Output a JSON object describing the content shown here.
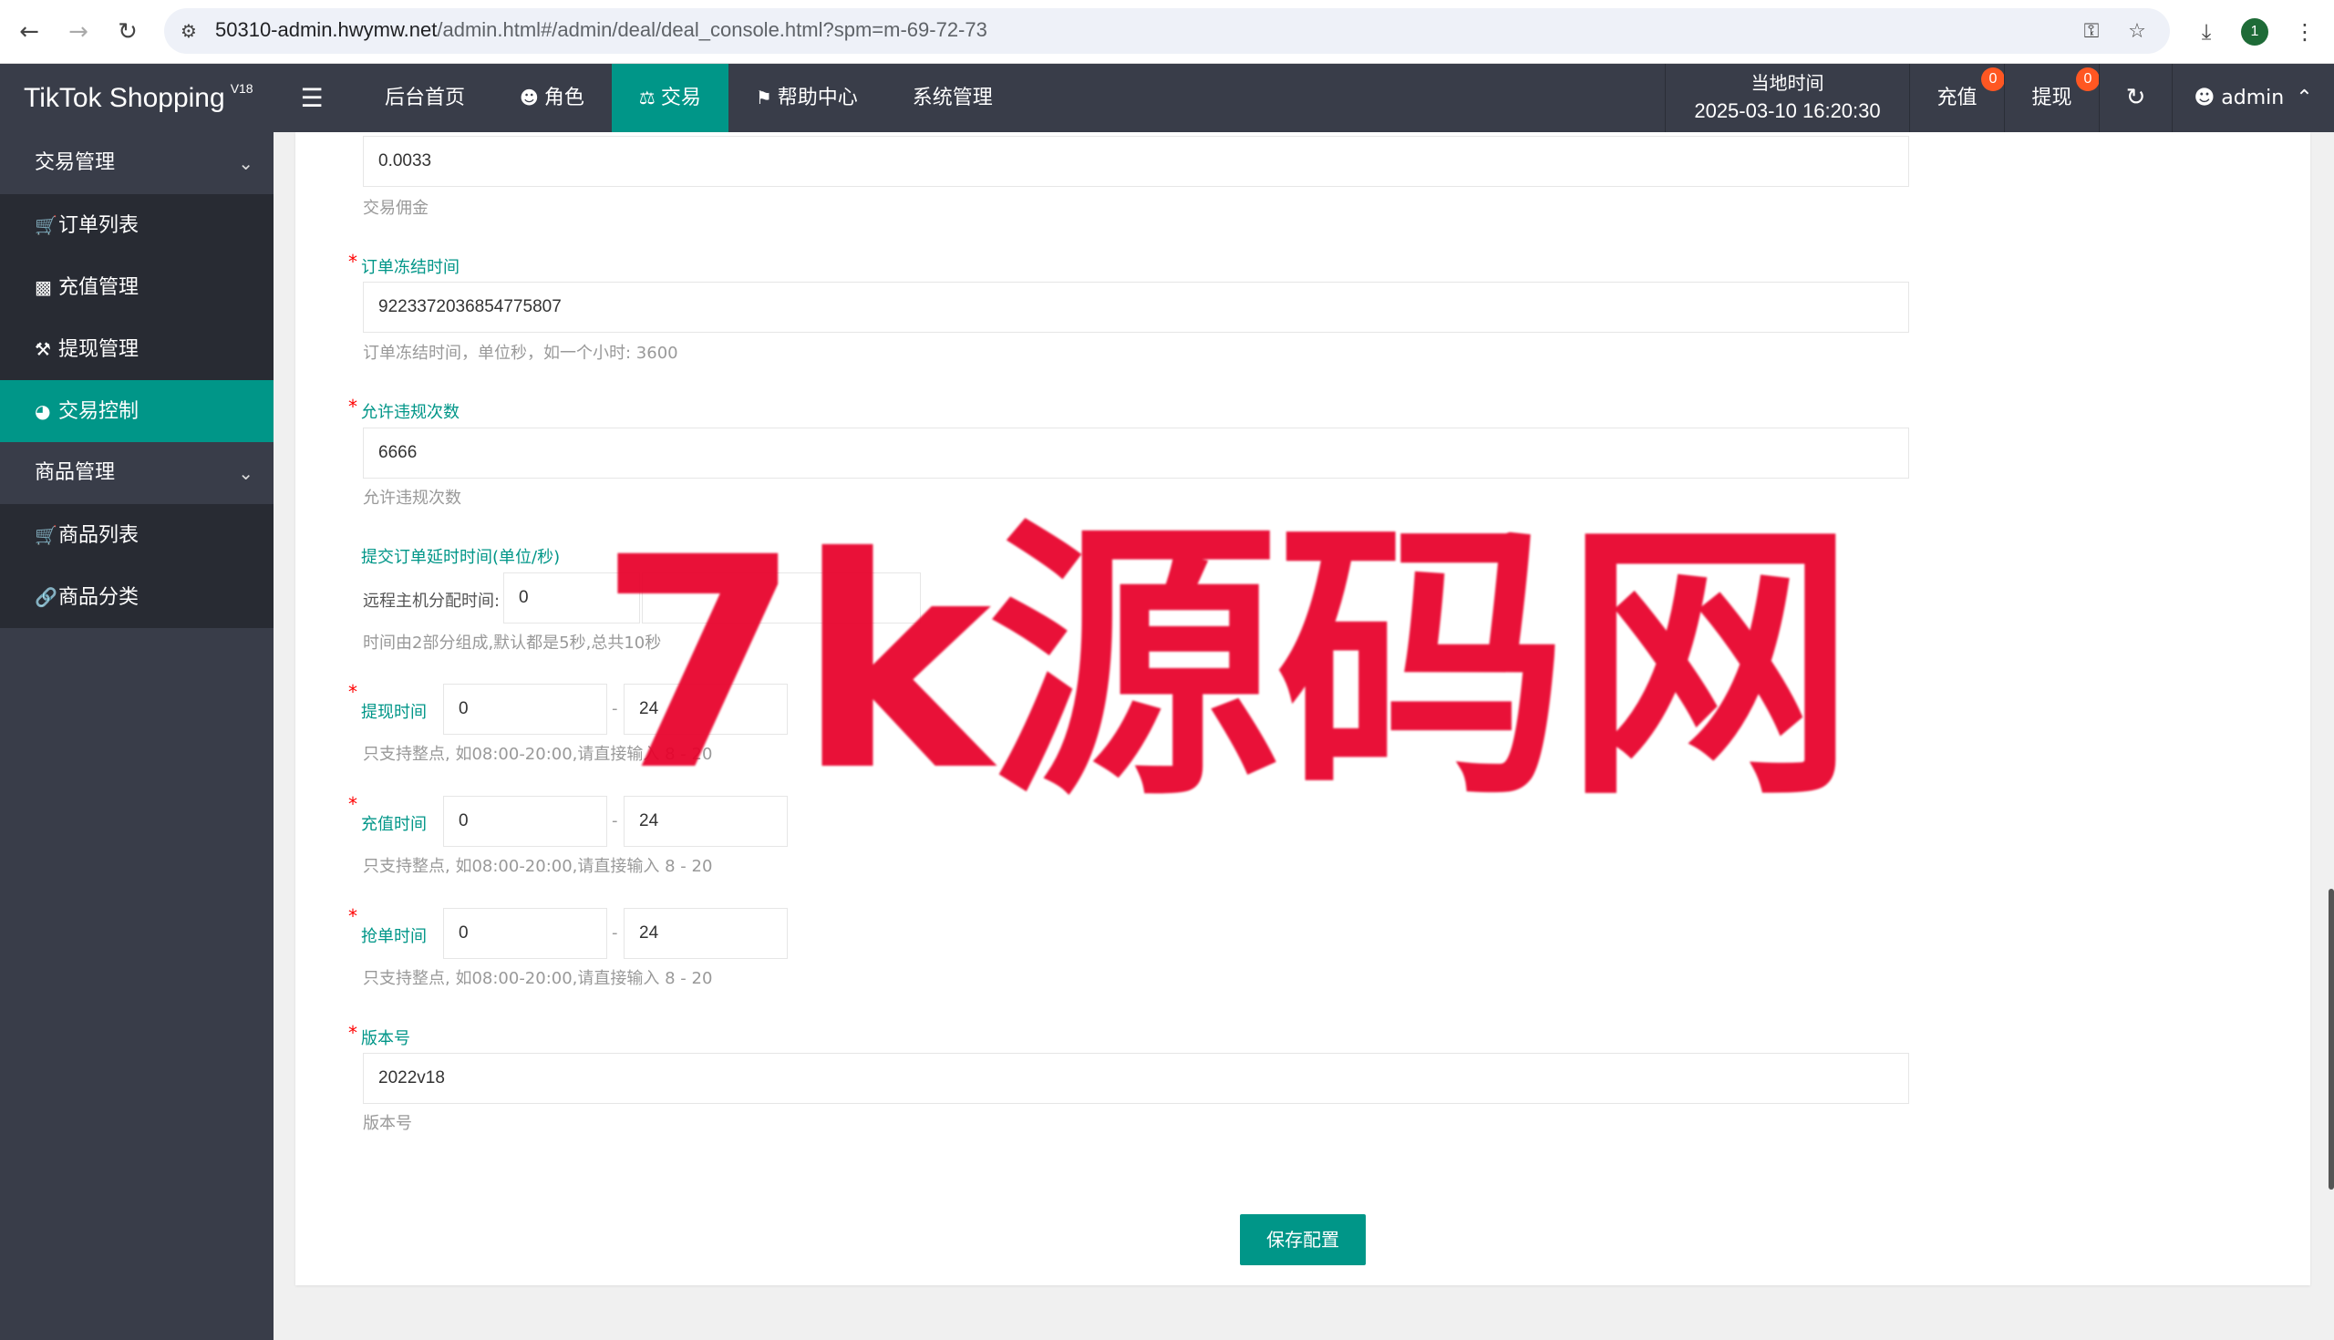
{
  "browser": {
    "host": "50310-admin.hwymw.net",
    "path": "/admin.html#/admin/deal/deal_console.html?spm=m-69-72-73",
    "profile_initial": "1"
  },
  "header": {
    "logo_text": "TikTok Shopping",
    "logo_version": "V18",
    "nav": [
      {
        "label": "后台首页"
      },
      {
        "label": "角色"
      },
      {
        "label": "交易"
      },
      {
        "label": "帮助中心"
      },
      {
        "label": "系统管理"
      }
    ],
    "time_label": "当地时间",
    "time_value": "2025-03-10 16:20:30",
    "recharge_label": "充值",
    "recharge_count": "0",
    "withdraw_label": "提现",
    "withdraw_count": "0",
    "user_label": "admin"
  },
  "sidebar": {
    "groups": [
      {
        "label": "交易管理",
        "items": [
          {
            "label": "订单列表"
          },
          {
            "label": "充值管理"
          },
          {
            "label": "提现管理"
          },
          {
            "label": "交易控制"
          }
        ]
      },
      {
        "label": "商品管理",
        "items": [
          {
            "label": "商品列表"
          },
          {
            "label": "商品分类"
          }
        ]
      }
    ]
  },
  "form": {
    "commission": {
      "value": "0.0033",
      "help": "交易佣金"
    },
    "freeze": {
      "label": "订单冻结时间",
      "value": "9223372036854775807",
      "help": "订单冻结时间，单位秒，如一个小时: 3600"
    },
    "violations": {
      "label": "允许违规次数",
      "value": "6666",
      "help": "允许违规次数"
    },
    "delay": {
      "label": "提交订单延时时间(单位/秒)",
      "remote_label": "远程主机分配时间:",
      "remote_value": "0",
      "help": "时间由2部分组成,默认都是5秒,总共10秒"
    },
    "withdraw_time": {
      "label": "提现时间",
      "from": "0",
      "to": "24",
      "help": "只支持整点, 如08:00-20:00,请直接输入 8 - 20"
    },
    "recharge_time": {
      "label": "充值时间",
      "from": "0",
      "to": "24",
      "help": "只支持整点, 如08:00-20:00,请直接输入 8 - 20"
    },
    "grab_time": {
      "label": "抢单时间",
      "from": "0",
      "to": "24",
      "help": "只支持整点, 如08:00-20:00,请直接输入 8 - 20"
    },
    "version": {
      "label": "版本号",
      "value": "2022v18",
      "help": "版本号"
    },
    "dash": "-",
    "save_label": "保存配置"
  },
  "watermark": "7k源码网"
}
